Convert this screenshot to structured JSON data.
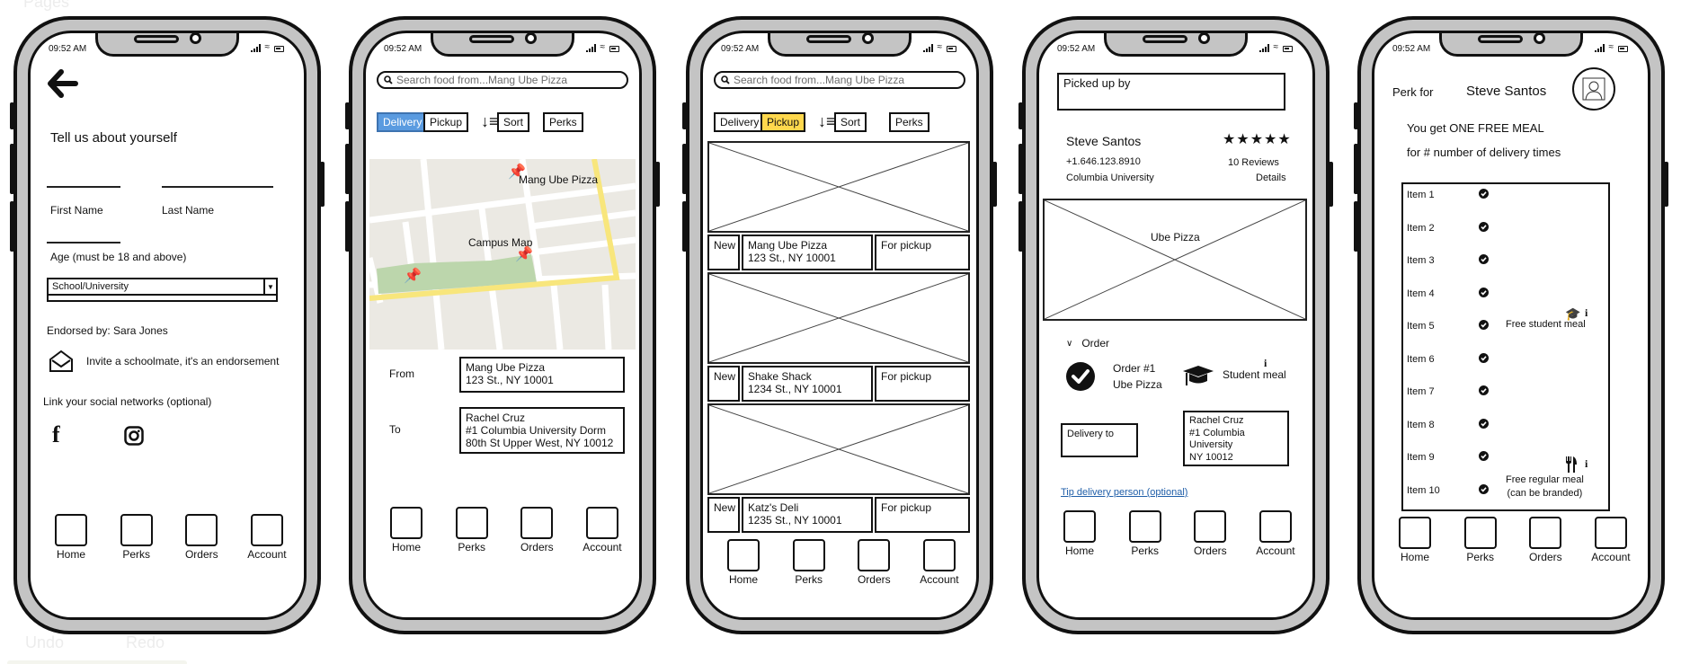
{
  "canvas": {
    "ghost_pages": "Pages",
    "ghost_undo": "Undo",
    "ghost_redo": "Redo"
  },
  "status_bar": {
    "time": "09:52 AM"
  },
  "tabbar": [
    "Home",
    "Perks",
    "Orders",
    "Account"
  ],
  "screen1": {
    "title": "Tell us about yourself",
    "first_name_label": "First Name",
    "last_name_label": "Last Name",
    "age_label": "Age  (must be 18 and above)",
    "school_select": "School/University",
    "endorsed_by": "Endorsed by: Sara Jones",
    "invite_text": "Invite a schoolmate, it's an endorsement",
    "social_label": "Link your social networks (optional)"
  },
  "screen2": {
    "search_placeholder": "Search food from...Mang Ube Pizza",
    "chips": {
      "delivery": "Delivery",
      "pickup": "Pickup",
      "sort": "Sort",
      "perks": "Perks"
    },
    "active_chip": "Delivery",
    "map": {
      "pin_label_1": "Mang Ube Pizza",
      "pin_label_2": "Campus Map"
    },
    "from_label": "From",
    "from_value": [
      "Mang Ube Pizza",
      "123 St., NY 10001"
    ],
    "to_label": "To",
    "to_value": [
      "Rachel Cruz",
      "#1 Columbia University Dorm",
      "80th St Upper West, NY 10012"
    ]
  },
  "screen3": {
    "search_placeholder": "Search food from...Mang Ube Pizza",
    "chips": {
      "delivery": "Delivery",
      "pickup": "Pickup",
      "sort": "Sort",
      "perks": "Perks"
    },
    "active_chip": "Pickup",
    "listings": [
      {
        "badge": "New",
        "name": "Mang Ube Pizza",
        "address": "123 St., NY 10001",
        "status": "For pickup"
      },
      {
        "badge": "New",
        "name": "Shake Shack",
        "address": "1234 St., NY 10001",
        "status": "For pickup"
      },
      {
        "badge": "New",
        "name": "Katz's Deli",
        "address": "1235 St., NY 10001",
        "status": "For pickup"
      }
    ]
  },
  "screen4": {
    "picked_up_by": "Picked up by",
    "driver_name": "Steve Santos",
    "rating_stars": 5,
    "phone": "+1.646.123.8910",
    "reviews": "10 Reviews",
    "school": "Columbia University",
    "details": "Details",
    "image_label": "Ube Pizza",
    "order_toggle": "Order",
    "order_number": "Order #1",
    "order_item": "Ube Pizza",
    "meal_type": "Student meal",
    "delivery_to_label": "Delivery to",
    "delivery_to_value": [
      "Rachel Cruz",
      "#1 Columbia",
      "University",
      "NY 10012"
    ],
    "tip_link": "Tip delivery person (optional)"
  },
  "screen5": {
    "perk_for_label": "Perk for",
    "user_name": "Steve Santos",
    "headline_1": "You get ONE FREE MEAL",
    "headline_2": "for # number of delivery times",
    "items": [
      "Item 1",
      "Item 2",
      "Item 3",
      "Item 4",
      "Item 5",
      "Item 6",
      "Item 7",
      "Item 8",
      "Item 9",
      "Item 10"
    ],
    "reward_student": "Free student meal",
    "reward_regular_1": "Free regular meal",
    "reward_regular_2": "(can be branded)"
  },
  "colors": {
    "frame": "#c4c4c4",
    "active_blue": "#5a9be0",
    "active_yellow": "#ffd84d",
    "link": "#1f5ea8",
    "map_bg": "#ebe9e3",
    "map_park": "#bcd6ac",
    "map_road_major": "#f8e67c"
  }
}
